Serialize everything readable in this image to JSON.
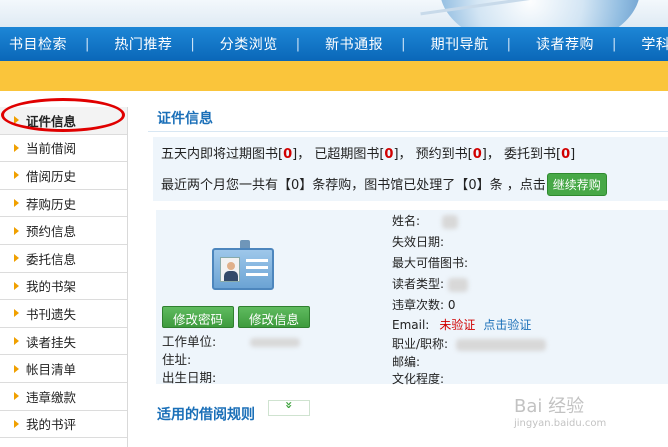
{
  "nav": {
    "items": [
      "书目检索",
      "热门推荐",
      "分类浏览",
      "新书通报",
      "期刊导航",
      "读者荐购",
      "学科参考"
    ],
    "separator": "|"
  },
  "sidebar": {
    "items": [
      {
        "label": "证件信息",
        "active": true
      },
      {
        "label": "当前借阅"
      },
      {
        "label": "借阅历史"
      },
      {
        "label": "荐购历史"
      },
      {
        "label": "预约信息"
      },
      {
        "label": "委托信息"
      },
      {
        "label": "我的书架"
      },
      {
        "label": "书刊遗失"
      },
      {
        "label": "读者挂失"
      },
      {
        "label": "帐目清单"
      },
      {
        "label": "违章缴款"
      },
      {
        "label": "我的书评"
      }
    ]
  },
  "main": {
    "title": "证件信息",
    "notice": {
      "line1": {
        "p1": "五天内即将过期图书[",
        "n1": "0",
        "p2": "]， 已超期图书[",
        "n2": "0",
        "p3": "]， 预约到书[",
        "n3": "0",
        "p4": "]，  委托到书[",
        "n4": "0",
        "p5": "]"
      },
      "line2": {
        "p1": "最近两个月您一共有【",
        "n1": "0",
        "p2": "】条荐购，图书馆已处理了【",
        "n2": "0",
        "p3": "】条 ，点击",
        "button": "继续荐购"
      }
    },
    "card": {
      "change_password": "修改密码",
      "edit_info": "修改信息",
      "left_fields": {
        "work_unit": "工作单位:",
        "address": "住址:",
        "birth_date": "出生日期:"
      },
      "right_fields": {
        "name": "姓名:",
        "expiry_date": "失效日期:",
        "max_borrow": "最大可借图书:",
        "reader_type": "读者类型:",
        "violations_label": "违章次数:",
        "violations_value": "0",
        "email_label": "Email:",
        "email_status": "未验证",
        "verify_link": "点击验证",
        "occupation": "职业/职称:",
        "postcode": "邮编:",
        "education": "文化程度:"
      }
    },
    "rules_title": "适用的借阅规则",
    "rules_toggle": "»"
  },
  "watermark": {
    "text": "Bai 经验",
    "sub": "jingyan.baidu.com"
  },
  "colors": {
    "nav_bg": "#0a67b8",
    "strip": "#fac53b",
    "accent": "#1a6fb8",
    "alert": "#d10000",
    "button": "#47a847",
    "highlight_oval": "#e00000"
  },
  "icons": {
    "sidebar_bullet": "triangle-right",
    "id_card": "id-card-icon"
  }
}
